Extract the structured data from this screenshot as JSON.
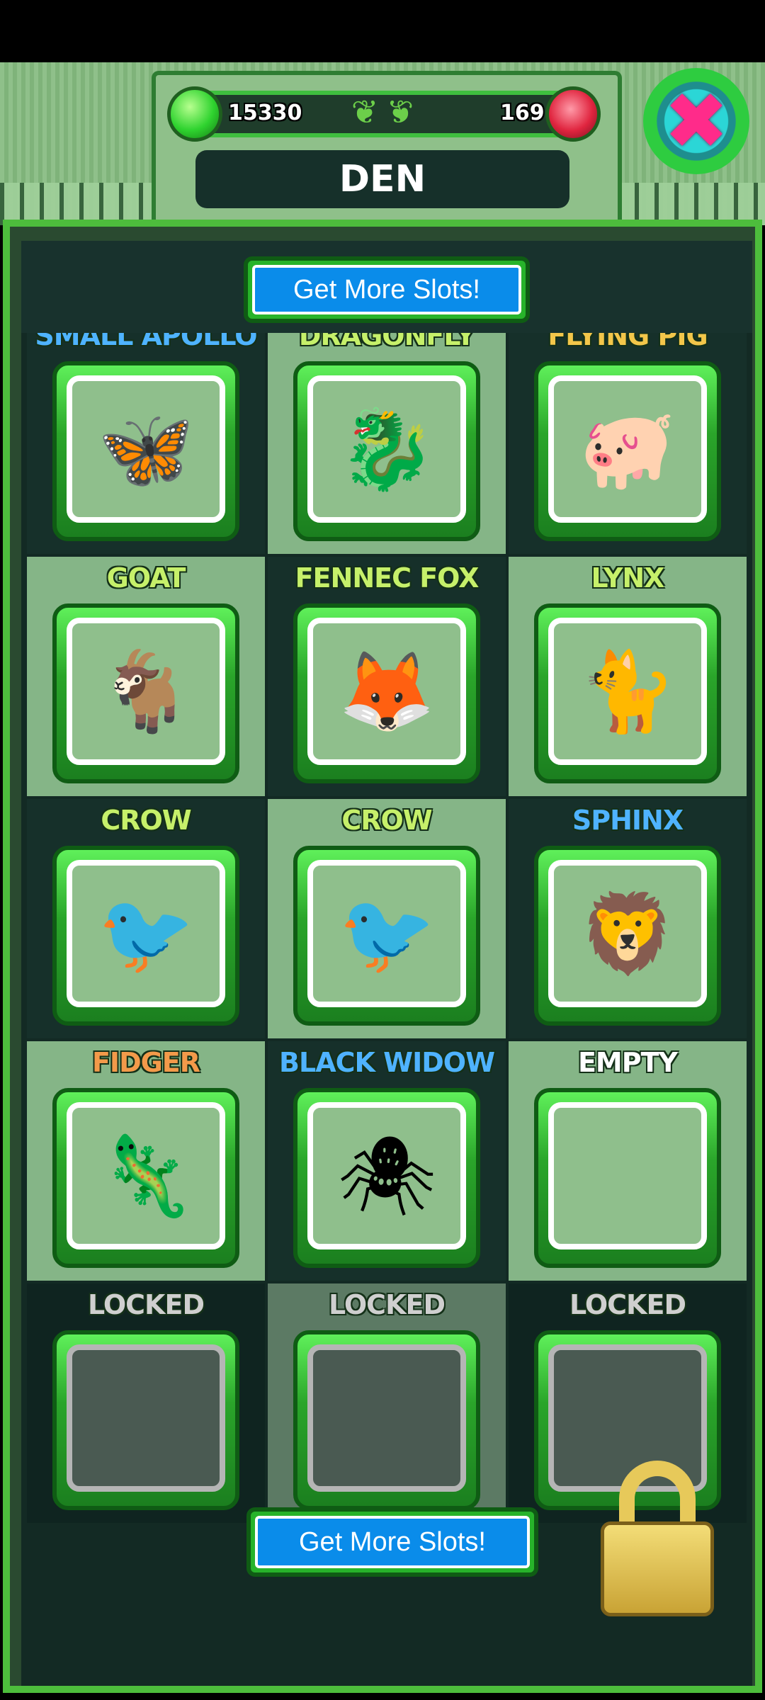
{
  "header": {
    "title": "DEN",
    "coins": "15330",
    "gems": "169",
    "close_icon": "close-x-icon"
  },
  "buttons": {
    "get_more_slots_top": "Get More Slots!",
    "get_more_slots_bottom": "Get More Slots!"
  },
  "slots": [
    {
      "name": "",
      "icon": "crocodile-icon",
      "glyph": "🐊",
      "color": "#c6f06a"
    },
    {
      "name": "",
      "icon": "wombat-icon",
      "glyph": "🐻",
      "color": "#c6f06a"
    },
    {
      "name": "",
      "icon": "rabbit-icon",
      "glyph": "🐇",
      "color": "#c6f06a"
    },
    {
      "name": "SMALL APOLLO",
      "icon": "butterfly-icon",
      "glyph": "🦋",
      "color": "#4fb3ff"
    },
    {
      "name": "DRAGONFLY",
      "icon": "dragonfly-icon",
      "glyph": "🐉",
      "color": "#c6f06a"
    },
    {
      "name": "FLYING PIG",
      "icon": "flying-pig-icon",
      "glyph": "🐖",
      "color": "#f3c64a"
    },
    {
      "name": "GOAT",
      "icon": "goat-icon",
      "glyph": "🐐",
      "color": "#c6f06a"
    },
    {
      "name": "FENNEC FOX",
      "icon": "fox-icon",
      "glyph": "🦊",
      "color": "#c6f06a"
    },
    {
      "name": "LYNX",
      "icon": "lynx-icon",
      "glyph": "🐈",
      "color": "#c6f06a"
    },
    {
      "name": "CROW",
      "icon": "crow-icon",
      "glyph": "🐦",
      "color": "#c6f06a"
    },
    {
      "name": "CROW",
      "icon": "crow-icon",
      "glyph": "🐦",
      "color": "#c6f06a"
    },
    {
      "name": "SPHINX",
      "icon": "sphinx-icon",
      "glyph": "🦁",
      "color": "#4fb3ff"
    },
    {
      "name": "FIDGER",
      "icon": "fidger-icon",
      "glyph": "🦎",
      "color": "#f39a4a"
    },
    {
      "name": "BLACK WIDOW",
      "icon": "spider-icon",
      "glyph": "🕷",
      "color": "#4fb3ff"
    },
    {
      "name": "EMPTY",
      "icon": "",
      "glyph": "",
      "color": "#ffffff"
    },
    {
      "name": "LOCKED",
      "icon": "",
      "glyph": "",
      "color": "#cfcfcf",
      "locked": true
    },
    {
      "name": "LOCKED",
      "icon": "",
      "glyph": "",
      "color": "#cfcfcf",
      "locked": true
    },
    {
      "name": "LOCKED",
      "icon": "",
      "glyph": "",
      "color": "#cfcfcf",
      "locked": true
    }
  ],
  "colors": {
    "accent_green": "#3fbf3f",
    "button_blue": "#0a8cea",
    "panel_dark": "#16302a",
    "panel_light": "#85b587"
  }
}
